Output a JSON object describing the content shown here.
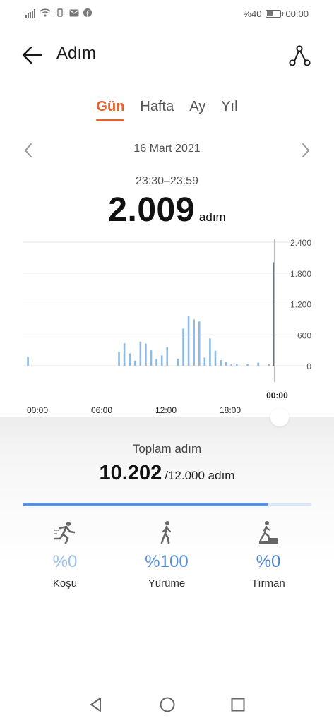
{
  "status_bar": {
    "battery": "%40",
    "time": "00:00",
    "battery_level": 0.4
  },
  "header": {
    "title": "Adım",
    "back_icon": "arrow-left-icon",
    "share_icon": "share-icon"
  },
  "tabs": [
    {
      "label": "Gün",
      "active": true
    },
    {
      "label": "Hafta",
      "active": false
    },
    {
      "label": "Ay",
      "active": false
    },
    {
      "label": "Yıl",
      "active": false
    }
  ],
  "date_nav": {
    "date": "16 Mart 2021"
  },
  "selection": {
    "time_range": "23:30–23:59",
    "value": "2.009",
    "unit": "adım"
  },
  "chart_data": {
    "type": "bar",
    "x_tick_labels": [
      "00:00",
      "06:00",
      "12:00",
      "18:00"
    ],
    "selected_label": "00:00",
    "y_tick_labels": [
      "2.400",
      "1.800",
      "1.200",
      "600",
      "0"
    ],
    "ylim": [
      0,
      2400
    ],
    "grid": true,
    "accent_color": "#2b7bd6",
    "bar_color": "#8dbbe6",
    "bars": [
      {
        "x": 0.5,
        "y": 170
      },
      {
        "x": 9.0,
        "y": 270
      },
      {
        "x": 9.5,
        "y": 440
      },
      {
        "x": 10.0,
        "y": 240
      },
      {
        "x": 10.5,
        "y": 100
      },
      {
        "x": 11.0,
        "y": 470
      },
      {
        "x": 11.5,
        "y": 430
      },
      {
        "x": 12.0,
        "y": 300
      },
      {
        "x": 12.5,
        "y": 130
      },
      {
        "x": 13.0,
        "y": 200
      },
      {
        "x": 13.5,
        "y": 360
      },
      {
        "x": 14.5,
        "y": 140
      },
      {
        "x": 15.0,
        "y": 720
      },
      {
        "x": 15.5,
        "y": 960
      },
      {
        "x": 16.0,
        "y": 900
      },
      {
        "x": 16.5,
        "y": 860
      },
      {
        "x": 17.0,
        "y": 160
      },
      {
        "x": 17.5,
        "y": 530
      },
      {
        "x": 18.0,
        "y": 290
      },
      {
        "x": 18.5,
        "y": 110
      },
      {
        "x": 19.0,
        "y": 80
      },
      {
        "x": 19.5,
        "y": 30
      },
      {
        "x": 20.0,
        "y": 30
      },
      {
        "x": 21.0,
        "y": 30
      },
      {
        "x": 22.0,
        "y": 60
      },
      {
        "x": 23.0,
        "y": 30
      },
      {
        "x": 23.5,
        "y": 2009,
        "selected": true
      }
    ]
  },
  "summary": {
    "label": "Toplam adım",
    "value": "10.202",
    "goal": "/12.000 adım",
    "progress": 0.85
  },
  "activities": [
    {
      "icon": "running-icon",
      "percent": "%0",
      "label": "Koşu",
      "color": "#9cc0ec"
    },
    {
      "icon": "walking-icon",
      "percent": "%100",
      "label": "Yürüme",
      "color": "#5b8fd8"
    },
    {
      "icon": "climbing-icon",
      "percent": "%0",
      "label": "Tırman",
      "color": "#4d82cf"
    }
  ],
  "nav": {
    "back": "triangle-back-icon",
    "home": "circle-home-icon",
    "recents": "square-recents-icon"
  }
}
